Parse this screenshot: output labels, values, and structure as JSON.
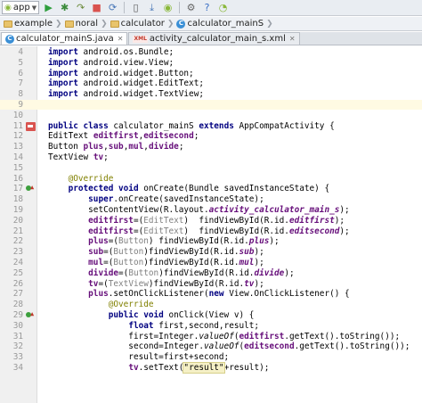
{
  "toolbar": {
    "run_config": "app",
    "buttons": [
      {
        "name": "run-button",
        "icon": "play-icon",
        "glyph": "▶",
        "color": "#2e9e3c"
      },
      {
        "name": "debug-button",
        "icon": "bug-icon",
        "glyph": "✱",
        "color": "#3a8a3a"
      },
      {
        "name": "attach-debugger-button",
        "icon": "attach-icon",
        "glyph": "↷",
        "color": "#6a8a3a"
      },
      {
        "name": "stop-button",
        "icon": "stop-icon",
        "glyph": "■",
        "color": "#d9534f"
      },
      {
        "name": "sync-button",
        "icon": "sync-icon",
        "glyph": "⟳",
        "color": "#4a78b8"
      },
      {
        "name": "avd-manager-button",
        "icon": "phone-icon",
        "glyph": "▯",
        "color": "#555555"
      },
      {
        "name": "sdk-manager-button",
        "icon": "download-icon",
        "glyph": "⤓",
        "color": "#4a78b8"
      },
      {
        "name": "monitor-button",
        "icon": "android-icon",
        "glyph": "◉",
        "color": "#8ab83a"
      },
      {
        "name": "settings-button",
        "icon": "gear-icon",
        "glyph": "⚙",
        "color": "#666666"
      },
      {
        "name": "help-button",
        "icon": "question-icon",
        "glyph": "?",
        "color": "#3a6fc4"
      },
      {
        "name": "android-button",
        "icon": "android-head-icon",
        "glyph": "◔",
        "color": "#8ab83a"
      }
    ]
  },
  "breadcrumb": [
    "example",
    "noral",
    "calculator",
    "calculator_mainS"
  ],
  "tabs": [
    {
      "label": "calculator_mainS.java",
      "active": true,
      "icon": "class-icon"
    },
    {
      "label": "activity_calculator_main_s.xml",
      "active": false,
      "icon": "xml-icon"
    }
  ],
  "lines": [
    {
      "n": "4",
      "current": false,
      "marker": null,
      "tokens": [
        {
          "t": "import",
          "c": "kw"
        },
        {
          "t": " android.os.Bundle;"
        }
      ]
    },
    {
      "n": "5",
      "current": false,
      "marker": null,
      "tokens": [
        {
          "t": "import",
          "c": "kw"
        },
        {
          "t": " android.view.View;"
        }
      ]
    },
    {
      "n": "6",
      "current": false,
      "marker": null,
      "tokens": [
        {
          "t": "import",
          "c": "kw"
        },
        {
          "t": " android.widget.Button;"
        }
      ]
    },
    {
      "n": "7",
      "current": false,
      "marker": null,
      "tokens": [
        {
          "t": "import",
          "c": "kw"
        },
        {
          "t": " android.widget.EditText;"
        }
      ]
    },
    {
      "n": "8",
      "current": false,
      "marker": null,
      "tokens": [
        {
          "t": "import",
          "c": "kw"
        },
        {
          "t": " android.widget.TextView;"
        }
      ]
    },
    {
      "n": "9",
      "current": true,
      "marker": null,
      "tokens": []
    },
    {
      "n": "10",
      "current": false,
      "marker": null,
      "tokens": []
    },
    {
      "n": "11",
      "current": false,
      "marker": "run",
      "tokens": [
        {
          "t": "public class",
          "c": "kw"
        },
        {
          "t": " calculator_mainS "
        },
        {
          "t": "extends",
          "c": "kw"
        },
        {
          "t": " AppCompatActivity {"
        }
      ]
    },
    {
      "n": "12",
      "current": false,
      "marker": null,
      "tokens": [
        {
          "t": "EditText "
        },
        {
          "t": "editfirst",
          "c": "fld"
        },
        {
          "t": ","
        },
        {
          "t": "editsecond",
          "c": "fld"
        },
        {
          "t": ";"
        }
      ]
    },
    {
      "n": "13",
      "current": false,
      "marker": null,
      "tokens": [
        {
          "t": "Button "
        },
        {
          "t": "plus",
          "c": "fld"
        },
        {
          "t": ","
        },
        {
          "t": "sub",
          "c": "fld"
        },
        {
          "t": ","
        },
        {
          "t": "mul",
          "c": "fld"
        },
        {
          "t": ","
        },
        {
          "t": "divide",
          "c": "fld"
        },
        {
          "t": ";"
        }
      ]
    },
    {
      "n": "14",
      "current": false,
      "marker": null,
      "tokens": [
        {
          "t": "TextView "
        },
        {
          "t": "tv",
          "c": "fld"
        },
        {
          "t": ";"
        }
      ]
    },
    {
      "n": "15",
      "current": false,
      "marker": null,
      "tokens": []
    },
    {
      "n": "16",
      "current": false,
      "marker": null,
      "tokens": [
        {
          "t": "    "
        },
        {
          "t": "@Override",
          "c": "ann"
        }
      ]
    },
    {
      "n": "17",
      "current": false,
      "marker": "impl",
      "tokens": [
        {
          "t": "    "
        },
        {
          "t": "protected void",
          "c": "kw"
        },
        {
          "t": " onCreate(Bundle savedInstanceState) {"
        }
      ]
    },
    {
      "n": "18",
      "current": false,
      "marker": null,
      "tokens": [
        {
          "t": "        "
        },
        {
          "t": "super",
          "c": "kw"
        },
        {
          "t": ".onCreate(savedInstanceState);"
        }
      ]
    },
    {
      "n": "19",
      "current": false,
      "marker": null,
      "tokens": [
        {
          "t": "        setContentView(R.layout."
        },
        {
          "t": "activity_calculator_main_s",
          "c": "fld-it"
        },
        {
          "t": ");"
        }
      ]
    },
    {
      "n": "20",
      "current": false,
      "marker": null,
      "tokens": [
        {
          "t": "        "
        },
        {
          "t": "editfirst",
          "c": "fld"
        },
        {
          "t": "=("
        },
        {
          "t": "EditText",
          "c": "cast"
        },
        {
          "t": ")  findViewById(R.id."
        },
        {
          "t": "editfirst",
          "c": "fld-it"
        },
        {
          "t": ");"
        }
      ]
    },
    {
      "n": "21",
      "current": false,
      "marker": null,
      "tokens": [
        {
          "t": "        "
        },
        {
          "t": "editfirst",
          "c": "fld"
        },
        {
          "t": "=("
        },
        {
          "t": "EditText",
          "c": "cast"
        },
        {
          "t": ")  findViewById(R.id."
        },
        {
          "t": "editsecond",
          "c": "fld-it"
        },
        {
          "t": ");"
        }
      ]
    },
    {
      "n": "22",
      "current": false,
      "marker": null,
      "tokens": [
        {
          "t": "        "
        },
        {
          "t": "plus",
          "c": "fld"
        },
        {
          "t": "=("
        },
        {
          "t": "Button",
          "c": "cast"
        },
        {
          "t": ") findViewById(R.id."
        },
        {
          "t": "plus",
          "c": "fld-it"
        },
        {
          "t": ");"
        }
      ]
    },
    {
      "n": "23",
      "current": false,
      "marker": null,
      "tokens": [
        {
          "t": "        "
        },
        {
          "t": "sub",
          "c": "fld"
        },
        {
          "t": "=("
        },
        {
          "t": "Button",
          "c": "cast"
        },
        {
          "t": ")findViewById(R.id."
        },
        {
          "t": "sub",
          "c": "fld-it"
        },
        {
          "t": ");"
        }
      ]
    },
    {
      "n": "24",
      "current": false,
      "marker": null,
      "tokens": [
        {
          "t": "        "
        },
        {
          "t": "mul",
          "c": "fld"
        },
        {
          "t": "=("
        },
        {
          "t": "Button",
          "c": "cast"
        },
        {
          "t": ")findViewById(R.id."
        },
        {
          "t": "mul",
          "c": "fld-it"
        },
        {
          "t": ");"
        }
      ]
    },
    {
      "n": "25",
      "current": false,
      "marker": null,
      "tokens": [
        {
          "t": "        "
        },
        {
          "t": "divide",
          "c": "fld"
        },
        {
          "t": "=("
        },
        {
          "t": "Button",
          "c": "cast"
        },
        {
          "t": ")findViewById(R.id."
        },
        {
          "t": "divide",
          "c": "fld-it"
        },
        {
          "t": ");"
        }
      ]
    },
    {
      "n": "26",
      "current": false,
      "marker": null,
      "tokens": [
        {
          "t": "        "
        },
        {
          "t": "tv",
          "c": "fld"
        },
        {
          "t": "=("
        },
        {
          "t": "TextView",
          "c": "cast"
        },
        {
          "t": ")findViewById(R.id."
        },
        {
          "t": "tv",
          "c": "fld-it"
        },
        {
          "t": ");"
        }
      ]
    },
    {
      "n": "27",
      "current": false,
      "marker": null,
      "tokens": [
        {
          "t": "        "
        },
        {
          "t": "plus",
          "c": "fld"
        },
        {
          "t": ".setOnClickListener("
        },
        {
          "t": "new",
          "c": "kw"
        },
        {
          "t": " View.OnClickListener() {"
        }
      ]
    },
    {
      "n": "28",
      "current": false,
      "marker": null,
      "tokens": [
        {
          "t": "            "
        },
        {
          "t": "@Override",
          "c": "ann"
        }
      ]
    },
    {
      "n": "29",
      "current": false,
      "marker": "impl",
      "tokens": [
        {
          "t": "            "
        },
        {
          "t": "public void",
          "c": "kw"
        },
        {
          "t": " onClick(View v) {"
        }
      ]
    },
    {
      "n": "30",
      "current": false,
      "marker": null,
      "tokens": [
        {
          "t": "                "
        },
        {
          "t": "float",
          "c": "kw"
        },
        {
          "t": " first,second,result;"
        }
      ]
    },
    {
      "n": "31",
      "current": false,
      "marker": null,
      "tokens": [
        {
          "t": "                first=Integer."
        },
        {
          "t": "valueOf",
          "c": "it"
        },
        {
          "t": "("
        },
        {
          "t": "editfirst",
          "c": "fld"
        },
        {
          "t": ".getText().toString());"
        }
      ]
    },
    {
      "n": "32",
      "current": false,
      "marker": null,
      "tokens": [
        {
          "t": "                second=Integer."
        },
        {
          "t": "valueOf",
          "c": "it"
        },
        {
          "t": "("
        },
        {
          "t": "editsecond",
          "c": "fld"
        },
        {
          "t": ".getText().toString());"
        }
      ]
    },
    {
      "n": "33",
      "current": false,
      "marker": null,
      "tokens": [
        {
          "t": "                result=first+second;"
        }
      ]
    },
    {
      "n": "34",
      "current": false,
      "marker": null,
      "tokens": [
        {
          "t": "                "
        },
        {
          "t": "tv",
          "c": "fld"
        },
        {
          "t": ".setText("
        },
        {
          "t": "\"result\"",
          "c": "str-hl"
        },
        {
          "t": "+result);"
        }
      ]
    }
  ]
}
